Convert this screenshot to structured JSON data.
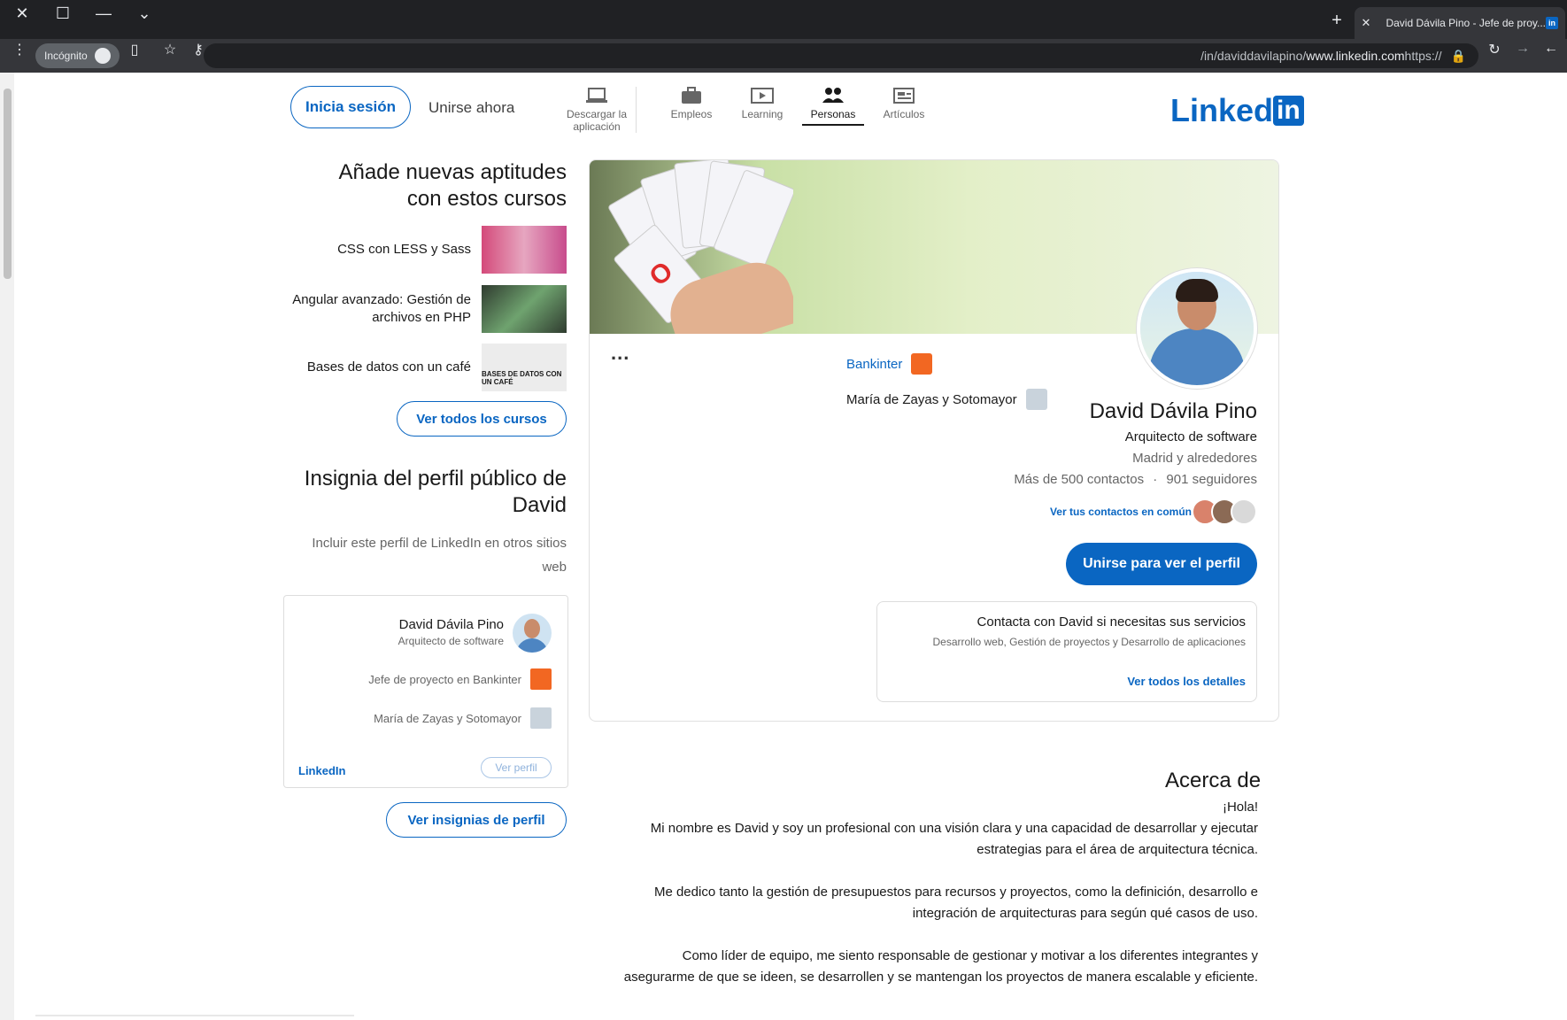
{
  "browser": {
    "tab_title": "David Dávila Pino - Jefe de proy...",
    "tab_favicon": "in",
    "url_prefix": "https://",
    "url_host": "www.linkedin.com",
    "url_path": "/in/daviddavilapino/",
    "incognito_label": "Incógnito"
  },
  "nav": {
    "logo_text": "Linked",
    "logo_in": "in",
    "items": [
      {
        "label": "Artículos"
      },
      {
        "label": "Personas"
      },
      {
        "label": "Learning"
      },
      {
        "label": "Empleos"
      },
      {
        "label": "Descargar la aplicación"
      }
    ],
    "join_now": "Unirse ahora",
    "sign_in": "Inicia sesión"
  },
  "profile": {
    "more": "...",
    "name": "David Dávila Pino",
    "headline": "Arquitecto de software",
    "location": "Madrid y alrededores",
    "followers": "901 seguidores",
    "connections": "Más de 500 contactos",
    "mutual_link": "Ver tus contactos en común",
    "join_button": "Unirse para ver el perfil",
    "companies": [
      {
        "name": "Bankinter",
        "color": "#f26722"
      },
      {
        "name": "María de Zayas y Sotomayor",
        "color": "#c9d3dc"
      }
    ],
    "services": {
      "title": "Contacta con David si necesitas sus servicios",
      "desc": "Desarrollo web, Gestión de proyectos y Desarrollo de aplicaciones",
      "link": "Ver todos los detalles"
    }
  },
  "about": {
    "heading": "Acerca de",
    "greeting": "¡Hola!",
    "p1": "Mi nombre es David y soy un profesional con una visión clara y una capacidad de desarrollar y ejecutar estrategias para el área de arquitectura técnica.",
    "p2": "Me dedico tanto la gestión de presupuestos para recursos y proyectos, como la definición, desarrollo e integración de arquitecturas para según qué casos de uso.",
    "p3": "Como líder de equipo, me siento responsable de gestionar y motivar a los diferentes integrantes y asegurarme de que se ideen, se desarrollen y se mantengan los proyectos de manera escalable y eficiente."
  },
  "courses": {
    "heading": "Añade nuevas aptitudes con estos cursos",
    "items": [
      {
        "title": "CSS con LESS y Sass"
      },
      {
        "title": "Angular avanzado: Gestión de archivos en PHP"
      },
      {
        "title": "Bases de datos con un café",
        "thumb_text": "BASES DE DATOS CON UN CAFÉ"
      }
    ],
    "see_all": "Ver todos los cursos"
  },
  "badge": {
    "heading": "Insignia del perfil público de David",
    "sub": "Incluir este perfil de LinkedIn en otros sitios web",
    "name": "David Dávila Pino",
    "headline": "Arquitecto de software",
    "job": "Jefe de proyecto en Bankinter",
    "school": "María de Zayas y Sotomayor",
    "view_profile": "Ver perfil",
    "logo": "LinkedIn",
    "see_badges": "Ver insignias de perfil"
  }
}
